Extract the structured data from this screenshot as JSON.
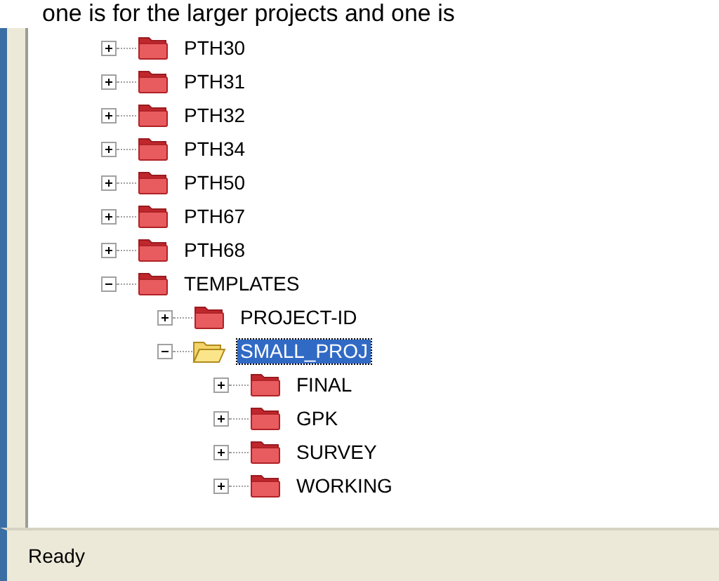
{
  "caption": "one is for the larger projects and one is",
  "tree": [
    {
      "label": "PTH30",
      "expanded": false,
      "selected": false
    },
    {
      "label": "PTH31",
      "expanded": false,
      "selected": false
    },
    {
      "label": "PTH32",
      "expanded": false,
      "selected": false
    },
    {
      "label": "PTH34",
      "expanded": false,
      "selected": false
    },
    {
      "label": "PTH50",
      "expanded": false,
      "selected": false
    },
    {
      "label": "PTH67",
      "expanded": false,
      "selected": false
    },
    {
      "label": "PTH68",
      "expanded": false,
      "selected": false
    },
    {
      "label": "TEMPLATES",
      "expanded": true,
      "selected": false,
      "children": [
        {
          "label": "PROJECT-ID",
          "expanded": false,
          "selected": false
        },
        {
          "label": "SMALL_PROJ",
          "expanded": true,
          "selected": true,
          "children": [
            {
              "label": "FINAL",
              "expanded": false,
              "selected": false
            },
            {
              "label": "GPK",
              "expanded": false,
              "selected": false
            },
            {
              "label": "SURVEY",
              "expanded": false,
              "selected": false
            },
            {
              "label": "WORKING",
              "expanded": false,
              "selected": false
            }
          ]
        }
      ]
    }
  ],
  "status_bar": "Ready"
}
